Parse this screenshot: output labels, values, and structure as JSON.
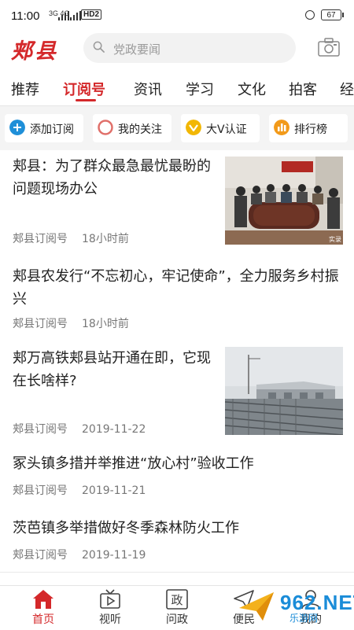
{
  "status_bar": {
    "time": "11:00",
    "signal": "3G 4G",
    "hd": "HD2",
    "battery": "67"
  },
  "header": {
    "logo": "郏县",
    "search_placeholder": "党政要闻"
  },
  "tabs": [
    {
      "label": "推荐",
      "active": false
    },
    {
      "label": "订阅号",
      "active": true
    },
    {
      "label": "资讯",
      "active": false
    },
    {
      "label": "学习",
      "active": false
    },
    {
      "label": "文化",
      "active": false
    },
    {
      "label": "拍客",
      "active": false
    },
    {
      "label": "经",
      "active": false
    }
  ],
  "quick_actions": [
    {
      "label": "添加订阅",
      "icon": "plus-circle-icon",
      "color": "#1f8fd8"
    },
    {
      "label": "我的关注",
      "icon": "circle-outline-icon",
      "color": "#e0706a"
    },
    {
      "label": "大V认证",
      "icon": "v-check-icon",
      "color": "#f2b705"
    },
    {
      "label": "排行榜",
      "icon": "bar-chart-icon",
      "color": "#f29a1a"
    }
  ],
  "articles": [
    {
      "title_lines": [
        "郏县：为了群众最急最忧最盼的",
        "问题现场办公"
      ],
      "source": "郏县订阅号",
      "time": "18小时前",
      "thumbnail": "meeting-photo",
      "thumb_text": "实录"
    },
    {
      "title_lines": [
        "郏县农发行“不忘初心，牢记使命”，全力服务乡村振",
        "兴"
      ],
      "source": "郏县订阅号",
      "time": "18小时前",
      "thumbnail": null
    },
    {
      "title_lines": [
        "郏万高铁郏县站开通在即，它现",
        "在长啥样?"
      ],
      "source": "郏县订阅号",
      "time": "2019-11-22",
      "thumbnail": "station-photo"
    },
    {
      "title_lines": [
        "冢头镇多措并举推进“放心村”验收工作"
      ],
      "source": "郏县订阅号",
      "time": "2019-11-21",
      "thumbnail": null
    },
    {
      "title_lines": [
        "茨芭镇多举措做好冬季森林防火工作"
      ],
      "source": "郏县订阅号",
      "time": "2019-11-19",
      "thumbnail": null
    }
  ],
  "bottom_nav": [
    {
      "label": "首页",
      "icon": "home-icon",
      "active": true
    },
    {
      "label": "视听",
      "icon": "tv-icon",
      "active": false
    },
    {
      "label": "问政",
      "icon": "zheng-icon",
      "active": false,
      "glyph": "政"
    },
    {
      "label": "便民",
      "icon": "paper-plane-icon",
      "active": false
    },
    {
      "label": "我的",
      "icon": "user-icon",
      "active": false
    }
  ],
  "watermark": {
    "text": "962.NET",
    "sub": "乐游网"
  },
  "colors": {
    "accent": "#d4282a",
    "gray_bg": "#f4f4f4",
    "meta": "#777777",
    "watermark": "#1a8cd8"
  }
}
